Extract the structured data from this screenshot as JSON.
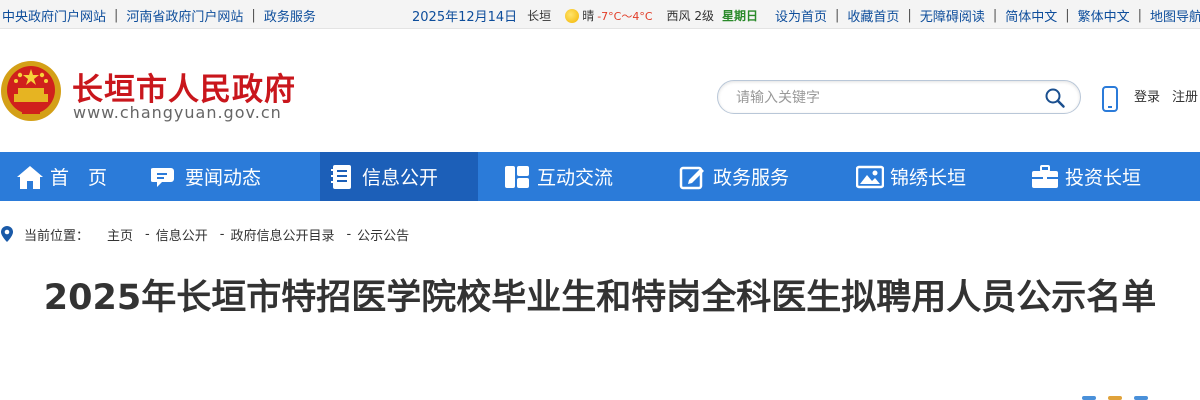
{
  "topbar": {
    "links_left": [
      "中央政府门户网站",
      "河南省政府门户网站",
      "政务服务"
    ],
    "date": "2025年12月14日",
    "city": "长垣",
    "weather": "晴",
    "temp": "-7°C～4°C",
    "wind": "西风 2级",
    "weekday": "星期日",
    "links_right": [
      "设为首页",
      "收藏首页",
      "无障碍阅读",
      "简体中文",
      "繁体中文",
      "地图导航"
    ]
  },
  "header": {
    "title": "长垣市人民政府",
    "url": "www.changyuan.gov.cn",
    "search_placeholder": "请输入关键字",
    "login": "登录",
    "register": "注册"
  },
  "nav": {
    "items": [
      {
        "label": "首　页",
        "icon": "home-icon"
      },
      {
        "label": "要闻动态",
        "icon": "chat-icon"
      },
      {
        "label": "信息公开",
        "icon": "notebook-icon"
      },
      {
        "label": "互动交流",
        "icon": "layout-icon"
      },
      {
        "label": "政务服务",
        "icon": "edit-icon"
      },
      {
        "label": "锦绣长垣",
        "icon": "picture-icon"
      },
      {
        "label": "投资长垣",
        "icon": "briefcase-icon"
      }
    ],
    "active_index": 2
  },
  "breadcrumb": {
    "label": "当前位置：",
    "items": [
      "主页",
      "信息公开",
      "政府信息公开目录",
      "公示公告"
    ]
  },
  "article": {
    "title": "2025年长垣市特招医学院校毕业生和特岗全科医生拟聘用人员公示名单"
  },
  "colors": {
    "nav_bg": "#2b7bd9",
    "nav_active": "#1c5fb8",
    "brand_red": "#c9161c",
    "link_blue": "#0d4d9b"
  }
}
